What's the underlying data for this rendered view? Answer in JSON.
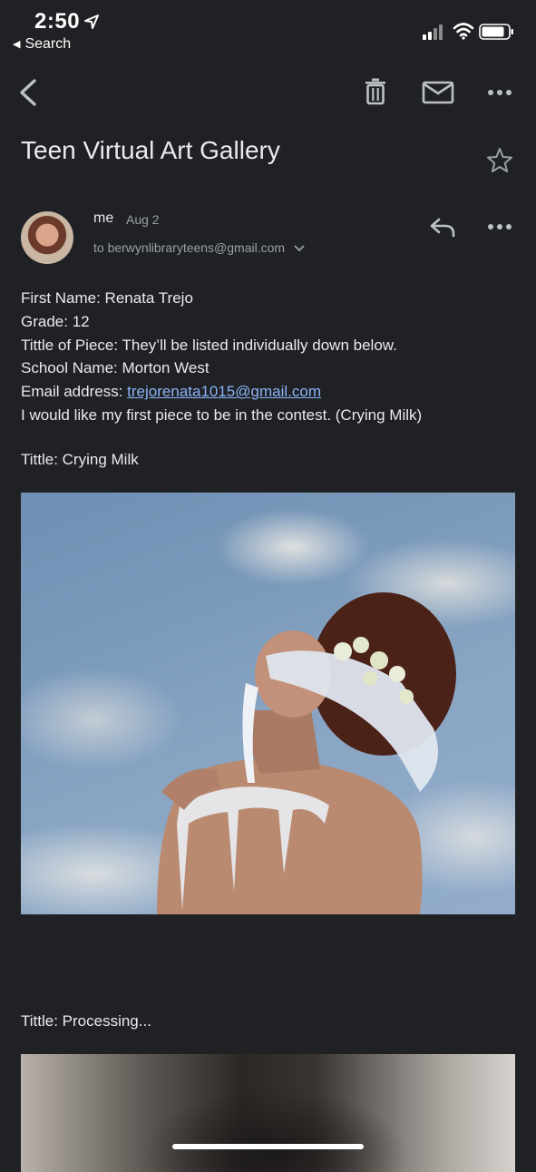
{
  "status_bar": {
    "time": "2:50",
    "back_label": "Search"
  },
  "toolbar": {
    "back_icon": "chevron-left-icon",
    "delete_icon": "trash-icon",
    "mark_icon": "mail-icon",
    "more_icon": "more-horiz-icon"
  },
  "email": {
    "subject": "Teen Virtual Art Gallery",
    "sender": "me",
    "date": "Aug 2",
    "recipient": "to berwynlibraryteens@gmail.com",
    "body_lines": [
      "First Name: Renata Trejo",
      "Grade: 12",
      "Tittle of Piece: They’ll be listed individually down below.",
      "School Name: Morton West"
    ],
    "email_label": "Email address: ",
    "email_link": "trejorenata1015@gmail.com",
    "contest_line": "I would like my first piece to be in the contest. (Crying Milk)",
    "piece1_title": "Tittle: Crying Milk",
    "piece2_title": "Tittle: Processing..."
  },
  "colors": {
    "background": "#202124",
    "text": "#e8eaed",
    "secondary": "#9aa0a6",
    "link": "#8ab4f8"
  }
}
